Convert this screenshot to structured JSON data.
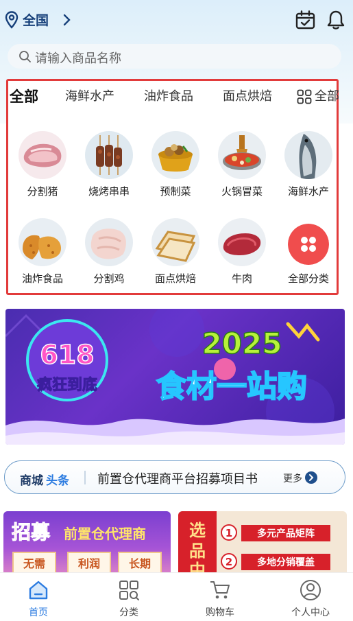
{
  "header": {
    "location": "全国"
  },
  "search": {
    "placeholder": "请输入商品名称"
  },
  "category_tabs": [
    "全部",
    "海鲜水产",
    "油炸食品",
    "面点烘焙",
    "全部"
  ],
  "categories": [
    {
      "label": "分割猪",
      "icon": "pork-icon"
    },
    {
      "label": "烧烤串串",
      "icon": "skewers-icon"
    },
    {
      "label": "预制菜",
      "icon": "prepared-dish-icon"
    },
    {
      "label": "火锅冒菜",
      "icon": "hotpot-icon"
    },
    {
      "label": "海鲜水产",
      "icon": "fish-icon"
    },
    {
      "label": "油炸食品",
      "icon": "fried-food-icon"
    },
    {
      "label": "分割鸡",
      "icon": "chicken-icon"
    },
    {
      "label": "面点烘焙",
      "icon": "bread-icon"
    },
    {
      "label": "牛肉",
      "icon": "beef-icon"
    },
    {
      "label": "全部分类",
      "icon": "all-categories-icon"
    }
  ],
  "banner": {
    "badge_top": "618",
    "badge_bottom": "疯狂到底",
    "year": "2025",
    "slogan": "食材一站购"
  },
  "news": {
    "tag_part1": "商城",
    "tag_part2": "头条",
    "headline": "前置仓代理商平台招募项目书",
    "more": "更多"
  },
  "promo_left": {
    "title": "招募",
    "subtitle": "前置仓代理商",
    "chips": [
      "无需",
      "利润",
      "长期"
    ]
  },
  "promo_right": {
    "title_chars": [
      "选",
      "品",
      "中"
    ],
    "items": [
      {
        "num": "1",
        "text": "多元产品矩阵"
      },
      {
        "num": "2",
        "text": "多地分销覆盖"
      }
    ]
  },
  "tabbar": [
    {
      "label": "首页",
      "active": true
    },
    {
      "label": "分类",
      "active": false
    },
    {
      "label": "购物车",
      "active": false
    },
    {
      "label": "个人中心",
      "active": false
    }
  ],
  "colors": {
    "accent": "#2b7be0",
    "highlight_border": "#e23b3b",
    "location_text": "#17407a"
  }
}
